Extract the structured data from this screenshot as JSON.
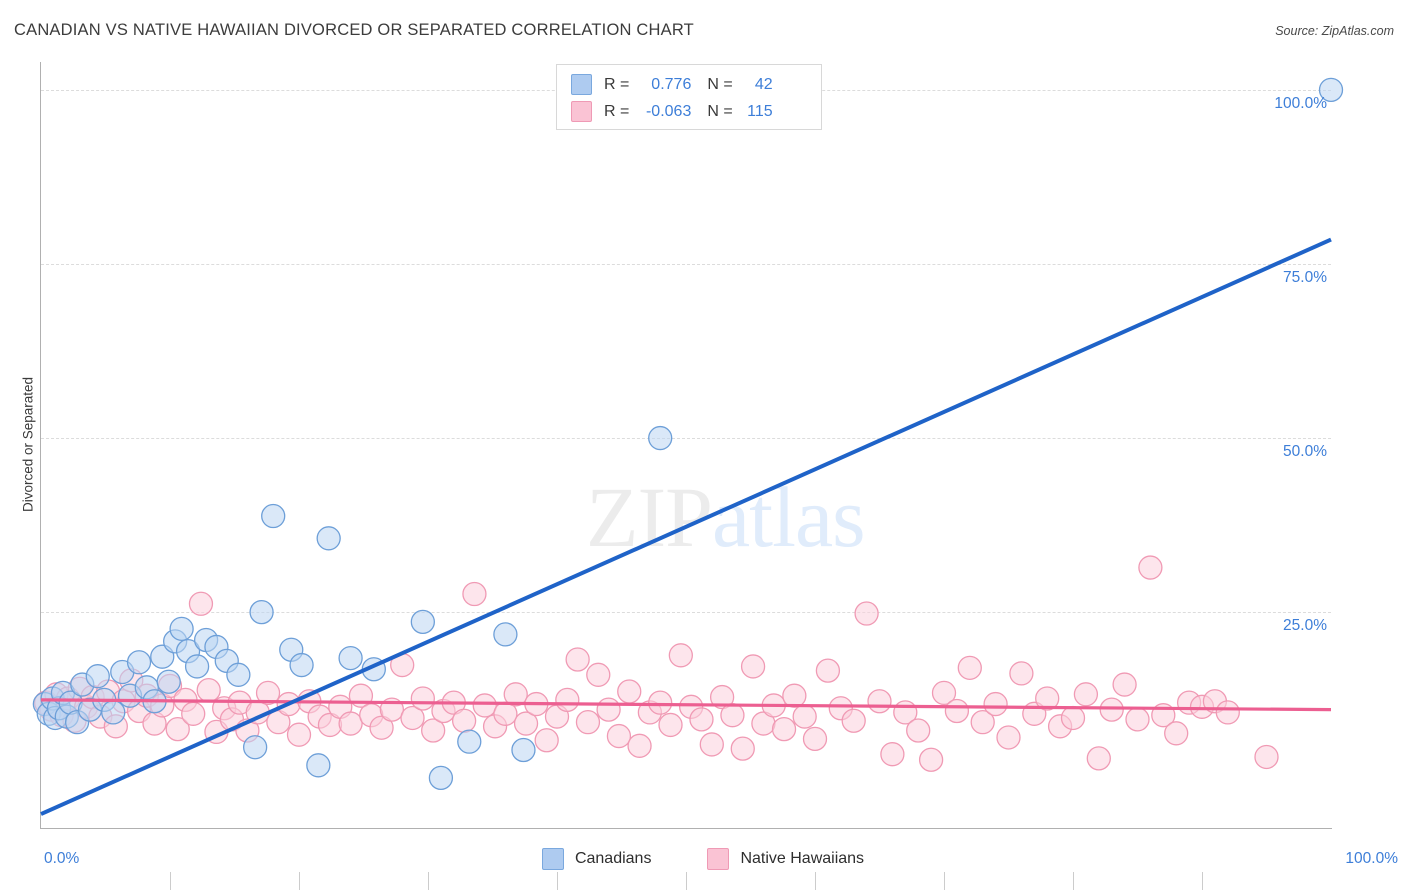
{
  "header": {
    "title": "CANADIAN VS NATIVE HAWAIIAN DIVORCED OR SEPARATED CORRELATION CHART",
    "source": "Source: ZipAtlas.com"
  },
  "watermark": {
    "part1": "ZIP",
    "part2": "atlas"
  },
  "correlation_legend": {
    "rows": [
      {
        "series": "Canadians",
        "r_key": "R =",
        "r_value": "0.776",
        "n_key": "N =",
        "n_value": "42",
        "color": "#aecbf0"
      },
      {
        "series": "Native Hawaiians",
        "r_key": "R =",
        "r_value": "-0.063",
        "n_key": "N =",
        "n_value": "115",
        "color": "#fac3d4"
      }
    ]
  },
  "series_legend": [
    {
      "label": "Canadians",
      "color": "#aecbf0",
      "border": "#7aa8de"
    },
    {
      "label": "Native Hawaiians",
      "color": "#fac3d4",
      "border": "#ef9ab5"
    }
  ],
  "axes": {
    "y_title": "Divorced or Separated",
    "y_ticks": [
      "100.0%",
      "75.0%",
      "50.0%",
      "25.0%"
    ],
    "y_tick_values": [
      100,
      75,
      50,
      25
    ],
    "x_min_label": "0.0%",
    "x_max_label": "100.0%"
  },
  "chart_data": {
    "type": "scatter",
    "title": "CANADIAN VS NATIVE HAWAIIAN DIVORCED OR SEPARATED CORRELATION CHART",
    "xlabel": "",
    "ylabel": "Divorced or Separated",
    "xlim": [
      0,
      100
    ],
    "ylim": [
      -6,
      104
    ],
    "grid": true,
    "gridlines_y": [
      25,
      50,
      75,
      100
    ],
    "legend_position": "bottom-center",
    "colors": {
      "canadian_fill": "#bcd6f2",
      "canadian_stroke": "#6d9fd8",
      "hawaiian_fill": "#fbd0dd",
      "hawaiian_stroke": "#f09ab4",
      "canadian_trend": "#1f63c8",
      "hawaiian_trend": "#ec5f91",
      "axis_text": "#3d7ed8",
      "gridline": "#dcdcdc"
    },
    "series": [
      {
        "name": "Canadians",
        "r": 0.776,
        "n": 42,
        "trendline": {
          "x0": 0,
          "y0": -4.0,
          "x1": 100,
          "y1": 78.5
        },
        "points": [
          [
            0.3,
            11.8
          ],
          [
            0.6,
            10.4
          ],
          [
            0.9,
            12.6
          ],
          [
            1.1,
            9.8
          ],
          [
            1.4,
            11.2
          ],
          [
            1.7,
            13.4
          ],
          [
            2.0,
            10.0
          ],
          [
            2.3,
            12.0
          ],
          [
            2.8,
            9.2
          ],
          [
            3.2,
            14.6
          ],
          [
            3.8,
            11.0
          ],
          [
            4.4,
            15.8
          ],
          [
            4.9,
            12.4
          ],
          [
            5.6,
            10.6
          ],
          [
            6.3,
            16.4
          ],
          [
            6.9,
            13.0
          ],
          [
            7.6,
            17.8
          ],
          [
            8.2,
            14.2
          ],
          [
            8.8,
            12.2
          ],
          [
            9.4,
            18.6
          ],
          [
            9.9,
            15.0
          ],
          [
            10.4,
            20.8
          ],
          [
            10.9,
            22.6
          ],
          [
            11.4,
            19.4
          ],
          [
            12.1,
            17.2
          ],
          [
            12.8,
            21.0
          ],
          [
            13.6,
            20.0
          ],
          [
            14.4,
            18.0
          ],
          [
            15.3,
            16.0
          ],
          [
            16.6,
            5.6
          ],
          [
            17.1,
            25.0
          ],
          [
            18.0,
            38.8
          ],
          [
            19.4,
            19.6
          ],
          [
            20.2,
            17.4
          ],
          [
            21.5,
            3.0
          ],
          [
            22.3,
            35.6
          ],
          [
            24.0,
            18.4
          ],
          [
            25.8,
            16.8
          ],
          [
            29.6,
            23.6
          ],
          [
            31.0,
            1.2
          ],
          [
            33.2,
            6.4
          ],
          [
            36.0,
            21.8
          ],
          [
            37.4,
            5.2
          ],
          [
            48.0,
            50.0
          ],
          [
            100.0,
            100.0
          ]
        ]
      },
      {
        "name": "Native Hawaiians",
        "r": -0.063,
        "n": 115,
        "trendline": {
          "x0": 0,
          "y0": 12.4,
          "x1": 100,
          "y1": 11.0
        },
        "points": [
          [
            0.4,
            12.0
          ],
          [
            0.8,
            11.0
          ],
          [
            1.2,
            13.2
          ],
          [
            1.6,
            10.2
          ],
          [
            2.1,
            12.6
          ],
          [
            2.6,
            9.4
          ],
          [
            3.0,
            14.0
          ],
          [
            3.5,
            11.4
          ],
          [
            4.0,
            12.8
          ],
          [
            4.6,
            10.0
          ],
          [
            5.2,
            13.6
          ],
          [
            5.8,
            8.6
          ],
          [
            6.4,
            12.2
          ],
          [
            7.0,
            15.2
          ],
          [
            7.6,
            10.8
          ],
          [
            8.2,
            13.0
          ],
          [
            8.8,
            9.0
          ],
          [
            9.4,
            11.6
          ],
          [
            10.0,
            14.4
          ],
          [
            10.6,
            8.2
          ],
          [
            11.2,
            12.4
          ],
          [
            11.8,
            10.4
          ],
          [
            12.4,
            26.2
          ],
          [
            13.0,
            13.8
          ],
          [
            13.6,
            7.8
          ],
          [
            14.2,
            11.2
          ],
          [
            14.8,
            9.6
          ],
          [
            15.4,
            12.0
          ],
          [
            16.0,
            8.0
          ],
          [
            16.8,
            10.6
          ],
          [
            17.6,
            13.4
          ],
          [
            18.4,
            9.2
          ],
          [
            19.2,
            11.8
          ],
          [
            20.0,
            7.4
          ],
          [
            20.8,
            12.2
          ],
          [
            21.6,
            10.0
          ],
          [
            22.4,
            8.8
          ],
          [
            23.2,
            11.4
          ],
          [
            24.0,
            9.0
          ],
          [
            24.8,
            13.0
          ],
          [
            25.6,
            10.2
          ],
          [
            26.4,
            8.4
          ],
          [
            27.2,
            11.0
          ],
          [
            28.0,
            17.4
          ],
          [
            28.8,
            9.8
          ],
          [
            29.6,
            12.6
          ],
          [
            30.4,
            8.0
          ],
          [
            31.2,
            10.8
          ],
          [
            32.0,
            12.0
          ],
          [
            32.8,
            9.4
          ],
          [
            33.6,
            27.6
          ],
          [
            34.4,
            11.6
          ],
          [
            35.2,
            8.6
          ],
          [
            36.0,
            10.4
          ],
          [
            36.8,
            13.2
          ],
          [
            37.6,
            9.0
          ],
          [
            38.4,
            11.8
          ],
          [
            39.2,
            6.6
          ],
          [
            40.0,
            10.0
          ],
          [
            40.8,
            12.4
          ],
          [
            41.6,
            18.2
          ],
          [
            42.4,
            9.2
          ],
          [
            43.2,
            16.0
          ],
          [
            44.0,
            11.0
          ],
          [
            44.8,
            7.2
          ],
          [
            45.6,
            13.6
          ],
          [
            46.4,
            5.8
          ],
          [
            47.2,
            10.6
          ],
          [
            48.0,
            12.0
          ],
          [
            48.8,
            8.8
          ],
          [
            49.6,
            18.8
          ],
          [
            50.4,
            11.4
          ],
          [
            51.2,
            9.6
          ],
          [
            52.0,
            6.0
          ],
          [
            52.8,
            12.8
          ],
          [
            53.6,
            10.2
          ],
          [
            54.4,
            5.4
          ],
          [
            55.2,
            17.2
          ],
          [
            56.0,
            9.0
          ],
          [
            56.8,
            11.6
          ],
          [
            57.6,
            8.2
          ],
          [
            58.4,
            13.0
          ],
          [
            59.2,
            10.0
          ],
          [
            60.0,
            6.8
          ],
          [
            61.0,
            16.6
          ],
          [
            62.0,
            11.2
          ],
          [
            63.0,
            9.4
          ],
          [
            64.0,
            24.8
          ],
          [
            65.0,
            12.2
          ],
          [
            66.0,
            4.6
          ],
          [
            67.0,
            10.6
          ],
          [
            68.0,
            8.0
          ],
          [
            69.0,
            3.8
          ],
          [
            70.0,
            13.4
          ],
          [
            71.0,
            10.8
          ],
          [
            72.0,
            17.0
          ],
          [
            73.0,
            9.2
          ],
          [
            74.0,
            11.8
          ],
          [
            75.0,
            7.0
          ],
          [
            76.0,
            16.2
          ],
          [
            77.0,
            10.4
          ],
          [
            78.0,
            12.6
          ],
          [
            79.0,
            8.6
          ],
          [
            80.0,
            9.8
          ],
          [
            81.0,
            13.2
          ],
          [
            82.0,
            4.0
          ],
          [
            83.0,
            11.0
          ],
          [
            84.0,
            14.6
          ],
          [
            85.0,
            9.6
          ],
          [
            86.0,
            31.4
          ],
          [
            87.0,
            10.2
          ],
          [
            88.0,
            7.6
          ],
          [
            89.0,
            12.0
          ],
          [
            90.0,
            11.4
          ],
          [
            91.0,
            12.2
          ],
          [
            92.0,
            10.6
          ],
          [
            95.0,
            4.2
          ]
        ]
      }
    ]
  }
}
